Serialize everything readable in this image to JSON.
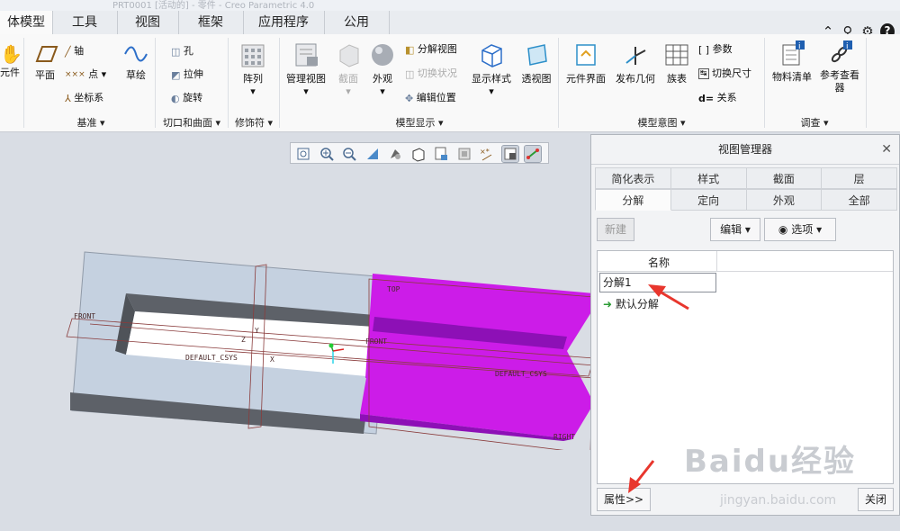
{
  "app": {
    "title": "PRT0001 [活动的] - 零件 - Creo Parametric 4.0"
  },
  "menu_tabs": [
    "体模型",
    "工具",
    "视图",
    "框架",
    "应用程序",
    "公用"
  ],
  "ribbon": {
    "items": {
      "component": "元件",
      "plane": "平面",
      "axis": "轴",
      "point": "点",
      "csys": "坐标系",
      "sketch": "草绘",
      "hole": "孔",
      "extrude": "拉伸",
      "revolve": "旋转",
      "pattern": "阵列",
      "manage_views": "管理视图",
      "section": "截面",
      "appearance": "外观",
      "explode_view": "分解视图",
      "toggle_status": "切换状况",
      "edit_position": "编辑位置",
      "display_style": "显示样式",
      "perspective": "透视图",
      "component_interface": "元件界面",
      "publish_geometry": "发布几何",
      "family_table": "族表",
      "parameters": "参数",
      "switch_dimensions": "切换尺寸",
      "relations": "关系",
      "bill_of_materials": "物料清单",
      "reference_viewer": "参考查看器"
    },
    "groups": [
      "基准",
      "切口和曲面",
      "修饰符",
      "模型显示",
      "模型意图",
      "调查"
    ]
  },
  "view_manager": {
    "title": "视图管理器",
    "tabs_row1": [
      "简化表示",
      "样式",
      "截面",
      "层"
    ],
    "tabs_row2": [
      "分解",
      "定向",
      "外观",
      "全部"
    ],
    "new_label": "新建",
    "edit_label": "编辑",
    "options_label": "选项",
    "column_name": "名称",
    "edit_value": "分解1",
    "default_item": "默认分解",
    "properties_label": "属性>>",
    "close_label": "关闭"
  },
  "model_labels": {
    "front_left": "FRONT",
    "top": "TOP",
    "front_mid": "FRONT",
    "csys_left": "DEFAULT_CSYS",
    "csys_right": "DEFAULT_CSYS",
    "right_bottom": "RIGHT",
    "axis_x": "X",
    "axis_y": "Y",
    "axis_z": "Z"
  },
  "watermark": {
    "brand": "Baidu经验",
    "url": "jingyan.baidu.com"
  },
  "colors": {
    "magenta": "#cc1ce8",
    "magenta_dark": "#8d10b6",
    "block_face": "#c5d1e0",
    "wall": "#5d6168"
  }
}
